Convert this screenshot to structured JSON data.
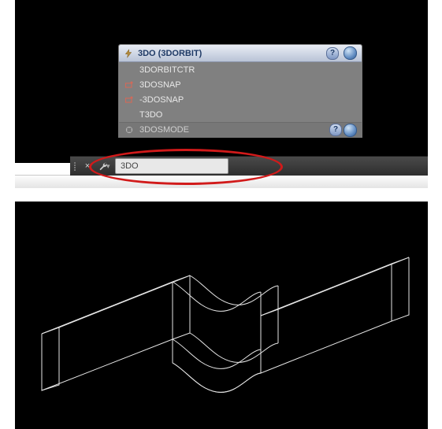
{
  "autocomplete": {
    "header": "3DO (3DORBIT)",
    "items": [
      {
        "icon": "none",
        "label": "3DORBITCTR"
      },
      {
        "icon": "osnap",
        "label": "3DOSNAP"
      },
      {
        "icon": "osnap",
        "label": "-3DOSNAP"
      },
      {
        "icon": "none",
        "label": "T3DO"
      }
    ],
    "footer_label": "3DOSMODE"
  },
  "command_line": {
    "typed": "3DO"
  },
  "icons": {
    "bolt": "bolt-icon",
    "close": "×",
    "wrench": "wrench-icon",
    "help": "?",
    "globe": "globe-icon",
    "chevron": "▾"
  }
}
